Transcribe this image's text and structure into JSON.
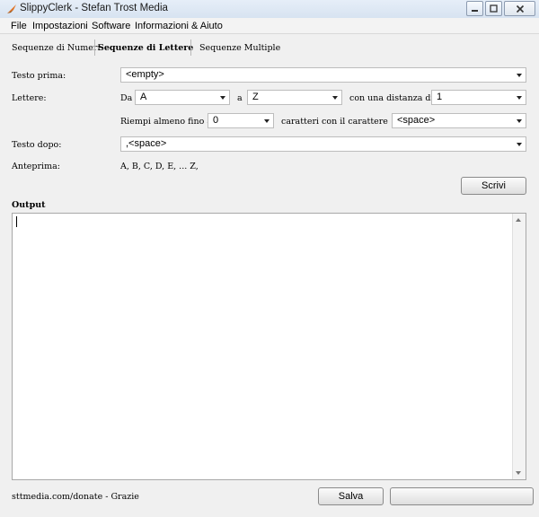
{
  "window": {
    "title": "SlippyClerk - Stefan Trost Media"
  },
  "menu": [
    "File",
    "Impostazioni",
    "Software",
    "Informazioni & Aiuto"
  ],
  "tabs": [
    {
      "label": "Sequenze di Numeri",
      "active": false
    },
    {
      "label": "Sequenze di Lettere",
      "active": true
    },
    {
      "label": "Sequenze Multiple",
      "active": false
    }
  ],
  "form": {
    "testo_prima": {
      "label": "Testo prima:",
      "value": "<empty>"
    },
    "lettere": {
      "label": "Lettere:",
      "da_label": "Da",
      "da_value": "A",
      "a_label": "a",
      "a_value": "Z",
      "distanza_label": "con una distanza di",
      "distanza_value": "1"
    },
    "riempi": {
      "label": "Riempi almeno fino a",
      "value": "0",
      "char_label": "caratteri con il carattere",
      "char_value": "<space>"
    },
    "testo_dopo": {
      "label": "Testo dopo:",
      "value": ",<space>"
    },
    "anteprima": {
      "label": "Anteprima:",
      "value": "A, B, C, D, E, ... Z,"
    }
  },
  "buttons": {
    "scrivi": "Scrivi",
    "salva": "Salva"
  },
  "output": {
    "label": "Output",
    "value": ""
  },
  "footer": {
    "donate": "sttmedia.com/donate - Grazie"
  },
  "colors": {
    "titlebar": "#dce6f2",
    "background": "#f0f0f0",
    "field": "#ffffff"
  }
}
